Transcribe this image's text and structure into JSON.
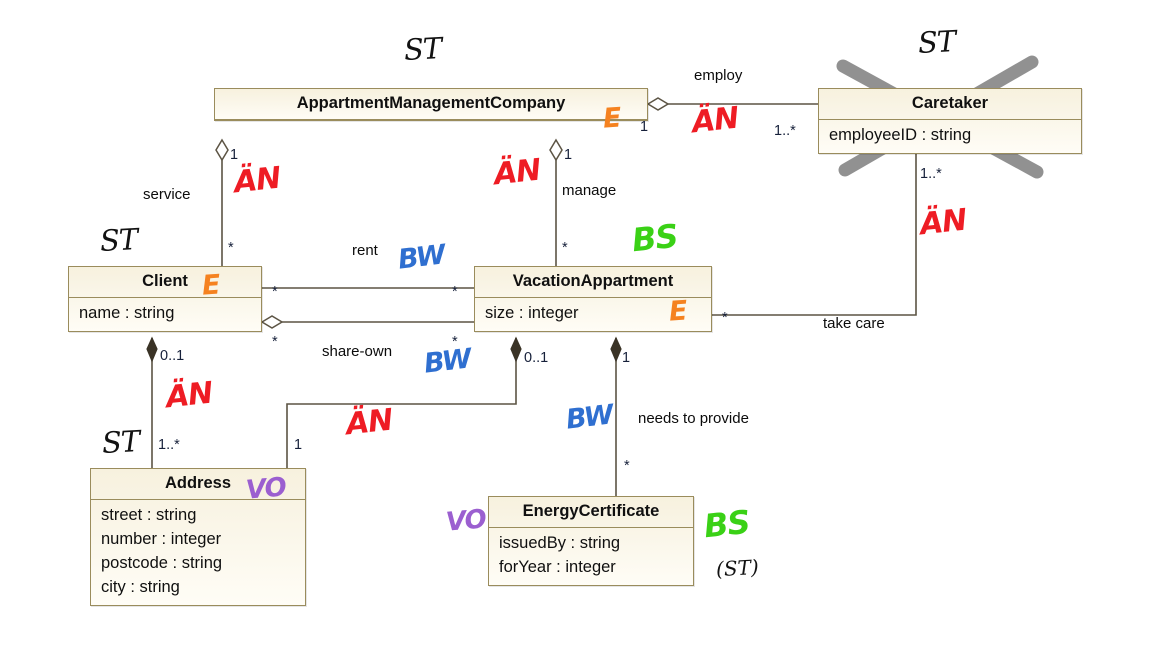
{
  "diagram": {
    "title": "UML class diagram with handwritten review marks",
    "colors": {
      "class_fill": "#faf6e9",
      "class_border": "#9a8c5c",
      "line": "#5c5444",
      "annotation_st": "#121212",
      "annotation_an": "#ee1c24",
      "annotation_bw": "#2f6fd0",
      "annotation_bs": "#3ad116",
      "annotation_e": "#f58220",
      "annotation_vo": "#9b5fd0",
      "strikeout": "#8c8c8c"
    },
    "classes": [
      {
        "id": "company",
        "name": "AppartmentManagementCompany",
        "attributes": [],
        "stereotype_mark": "E",
        "struck_out": false
      },
      {
        "id": "caretaker",
        "name": "Caretaker",
        "attributes": [
          "employeeID : string"
        ],
        "stereotype_mark": "",
        "struck_out": true
      },
      {
        "id": "client",
        "name": "Client",
        "attributes": [
          "name : string"
        ],
        "stereotype_mark": "E",
        "struck_out": false
      },
      {
        "id": "vacationappartment",
        "name": "VacationAppartment",
        "attributes": [
          "size : integer"
        ],
        "stereotype_mark": "E",
        "struck_out": false
      },
      {
        "id": "address",
        "name": "Address",
        "attributes": [
          "street : string",
          "number : integer",
          "postcode : string",
          "city : string"
        ],
        "stereotype_mark": "VO",
        "struck_out": false
      },
      {
        "id": "energycertificate",
        "name": "EnergyCertificate",
        "attributes": [
          "issuedBy : string",
          "forYear : integer"
        ],
        "stereotype_mark": "VO",
        "struck_out": false
      }
    ],
    "associations": [
      {
        "id": "employ",
        "label": "employ",
        "source_mult": "1",
        "target_mult": "1..*"
      },
      {
        "id": "service",
        "label": "service",
        "source_mult": "1",
        "target_mult": "*"
      },
      {
        "id": "manage",
        "label": "manage",
        "source_mult": "1",
        "target_mult": "*"
      },
      {
        "id": "rent",
        "label": "rent",
        "source_mult": "*",
        "target_mult": "*"
      },
      {
        "id": "shareown",
        "label": "share-own",
        "source_mult": "*",
        "target_mult": "*"
      },
      {
        "id": "takecare",
        "label": "take care",
        "source_mult": "*",
        "target_mult": "1..*"
      },
      {
        "id": "clientaddr",
        "label": "",
        "source_mult": "0..1",
        "target_mult": "1..*"
      },
      {
        "id": "vacaddr",
        "label": "",
        "source_mult": "0..1",
        "target_mult": "1"
      },
      {
        "id": "provide",
        "label": "needs to provide",
        "source_mult": "1",
        "target_mult": "*"
      }
    ],
    "annotations": [
      {
        "id": "st-company",
        "text": "ST",
        "kind": "st"
      },
      {
        "id": "st-caretaker",
        "text": "ST",
        "kind": "st"
      },
      {
        "id": "st-client",
        "text": "ST",
        "kind": "st"
      },
      {
        "id": "st-address",
        "text": "ST",
        "kind": "st"
      },
      {
        "id": "an-employ",
        "text": "ÄN",
        "kind": "an"
      },
      {
        "id": "an-service",
        "text": "ÄN",
        "kind": "an"
      },
      {
        "id": "an-manage",
        "text": "ÄN",
        "kind": "an"
      },
      {
        "id": "an-takecare",
        "text": "ÄN",
        "kind": "an"
      },
      {
        "id": "an-clientaddr",
        "text": "ÄN",
        "kind": "an"
      },
      {
        "id": "an-vacaddr",
        "text": "ÄN",
        "kind": "an"
      },
      {
        "id": "bw-rent",
        "text": "BW",
        "kind": "bw"
      },
      {
        "id": "bw-shareown",
        "text": "BW",
        "kind": "bw"
      },
      {
        "id": "bw-provide",
        "text": "BW",
        "kind": "bw"
      },
      {
        "id": "bs-vacation",
        "text": "BS",
        "kind": "bs"
      },
      {
        "id": "bs-energy",
        "text": "BS",
        "kind": "bs"
      },
      {
        "id": "st-energy",
        "text": "(ST)",
        "kind": "stsmall"
      },
      {
        "id": "e-company",
        "text": "E",
        "kind": "e"
      },
      {
        "id": "e-client",
        "text": "E",
        "kind": "e"
      },
      {
        "id": "e-vacation",
        "text": "E",
        "kind": "e"
      },
      {
        "id": "vo-address",
        "text": "VO",
        "kind": "vo"
      },
      {
        "id": "vo-energy",
        "text": "VO",
        "kind": "vo"
      }
    ]
  }
}
